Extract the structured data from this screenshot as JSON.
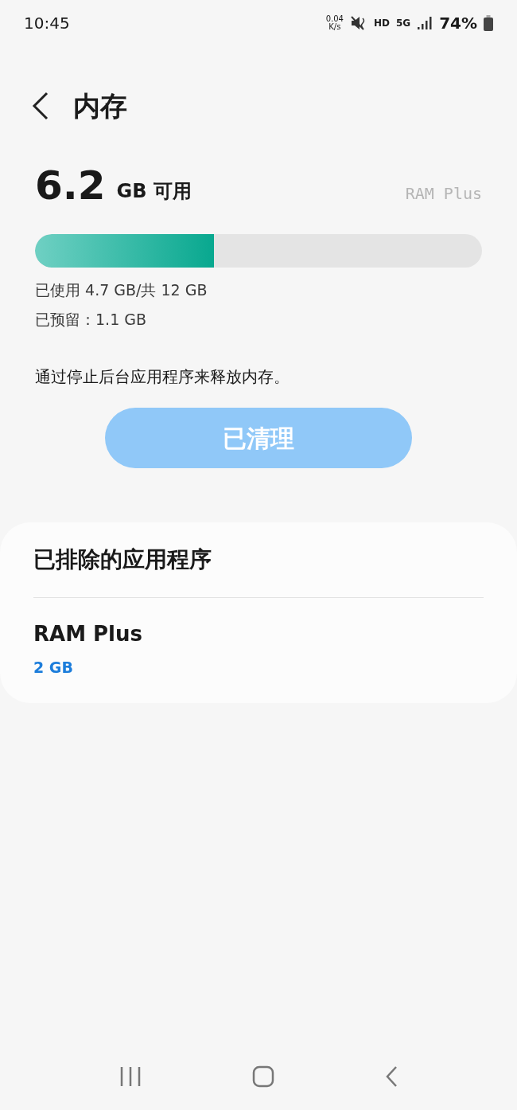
{
  "status_bar": {
    "time": "10:45",
    "net_speed": "0.04",
    "net_unit": "K/s",
    "hd": "HD",
    "network": "5G",
    "battery": "74%"
  },
  "header": {
    "title": "内存"
  },
  "summary": {
    "value": "6.2",
    "unit": "GB 可用",
    "ram_plus_link": "RAM Plus",
    "level": 0.4,
    "used": "已使用 4.7 GB/共 12 GB",
    "reserved": "已预留：1.1 GB"
  },
  "hint": "通过停止后台应用程序来释放内存。",
  "clean_button": {
    "label": "已清理",
    "disabled": true
  },
  "excluded_card": {
    "title": "已排除的应用程序",
    "items": [
      {
        "title": "RAM Plus",
        "value": "2 GB"
      }
    ]
  }
}
